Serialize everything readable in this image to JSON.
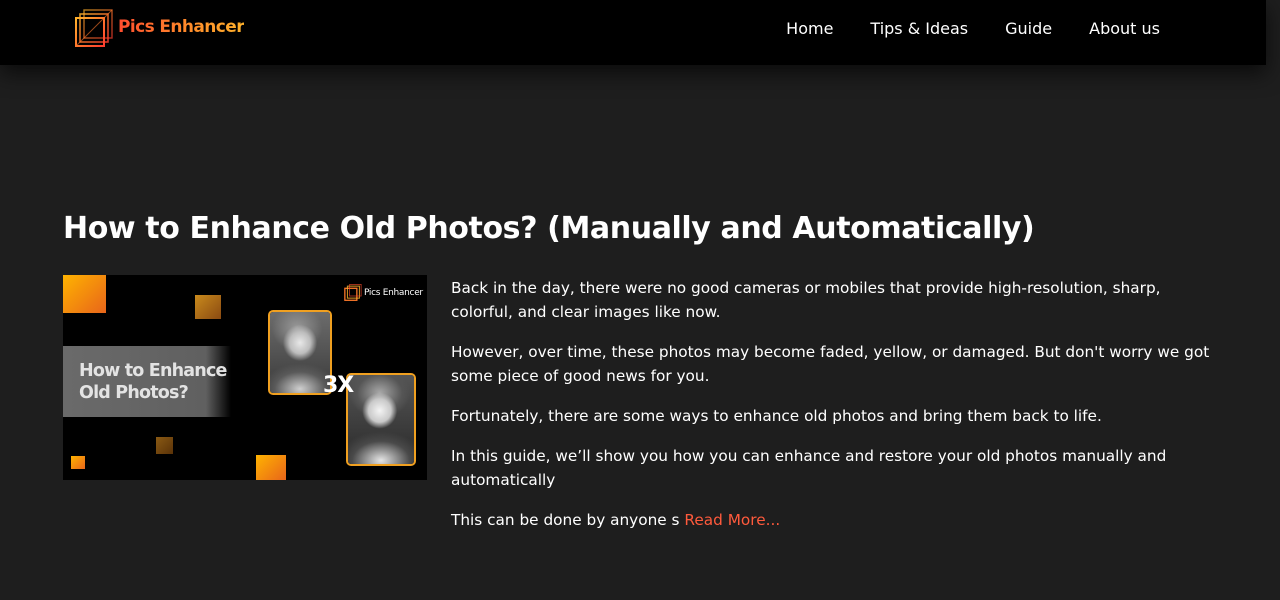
{
  "header": {
    "logo_text": "Pics Enhancer",
    "nav": [
      {
        "label": "Home"
      },
      {
        "label": "Tips & Ideas"
      },
      {
        "label": "Guide"
      },
      {
        "label": "About us"
      }
    ]
  },
  "post": {
    "title": "How to Enhance Old Photos? (Manually and Automatically)",
    "thumbnail": {
      "heading": "How to Enhance Old Photos?",
      "logo_text": "Pics Enhancer",
      "zoom_label": "3X"
    },
    "paragraphs": [
      "Back in the day, there were no good cameras or mobiles that provide high-resolution, sharp, colorful, and clear images like now.",
      "However, over time, these photos may become faded, yellow, or damaged. But don't worry we got some piece of good news for you.",
      "Fortunately, there are some ways to enhance old photos and bring them back to life.",
      "In this guide, we’ll show you how you can enhance and restore your old photos manually and automatically"
    ],
    "excerpt_end": "This can be done by anyone s ",
    "read_more": "Read More..."
  },
  "colors": {
    "header_bg": "#000000",
    "page_bg": "#1e1e1e",
    "accent": "#ff5a3c",
    "brand_gradient_start": "#ff4d2e",
    "brand_gradient_end": "#ffb12b"
  }
}
